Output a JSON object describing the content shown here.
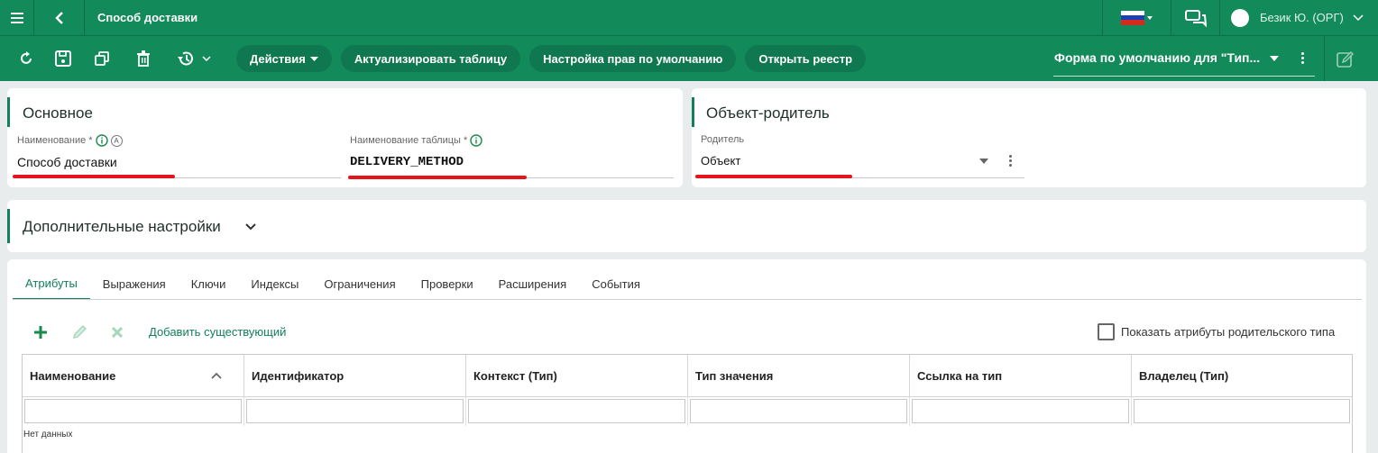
{
  "header": {
    "title": "Способ доставки",
    "user": "Безик Ю. (ОРГ)"
  },
  "toolbar": {
    "actions": "Действия",
    "refresh_table": "Актуализировать таблицу",
    "default_rights": "Настройка прав по умолчанию",
    "open_registry": "Открыть реестр",
    "form_select": "Форма по умолчанию для \"Тип..."
  },
  "main_card": {
    "title": "Основное",
    "name_label": "Наименование *",
    "name_value": "Способ доставки",
    "table_label": "Наименование таблицы *",
    "table_value": "DELIVERY_METHOD",
    "auto_badge": "A"
  },
  "parent_card": {
    "title": "Объект-родитель",
    "parent_label": "Родитель",
    "parent_value": "Объект"
  },
  "extra": {
    "title": "Дополнительные настройки"
  },
  "tabs": [
    "Атрибуты",
    "Выражения",
    "Ключи",
    "Индексы",
    "Ограничения",
    "Проверки",
    "Расширения",
    "События"
  ],
  "attrs": {
    "add_existing": "Добавить существующий",
    "show_parent": "Показать атрибуты родительского типа",
    "no_data": "Нет данных"
  },
  "columns": [
    "Наименование",
    "Идентификатор",
    "Контекст (Тип)",
    "Тип значения",
    "Ссылка на тип",
    "Владелец (Тип)"
  ],
  "colors": {
    "brand": "#128a5a",
    "accent": "#12805a",
    "highlight": "#e8141c"
  }
}
